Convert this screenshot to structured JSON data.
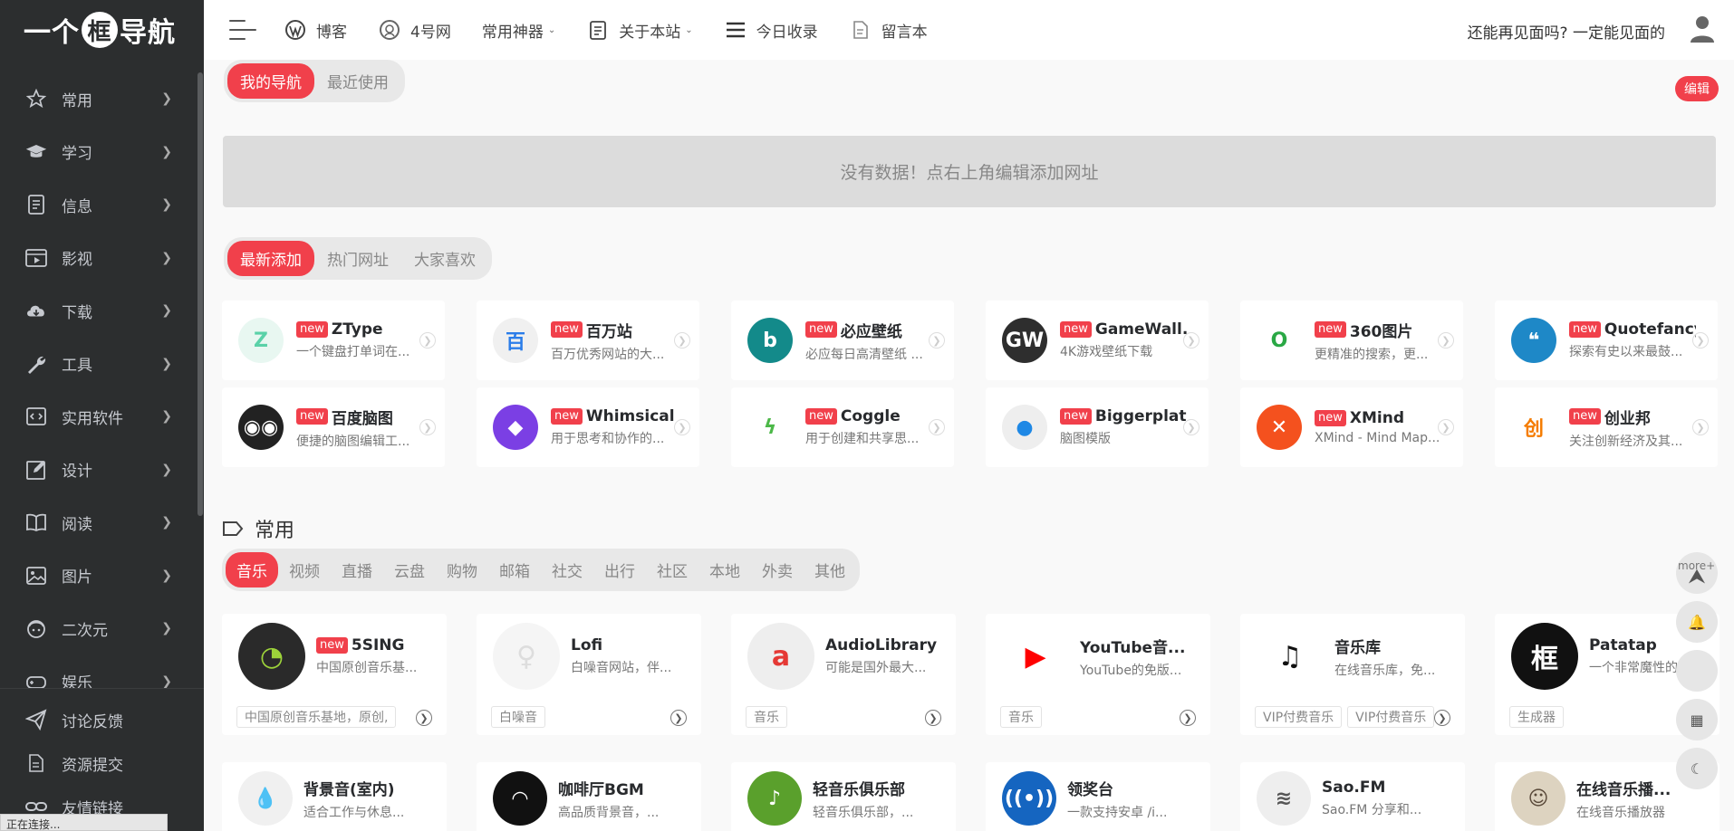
{
  "sidebar": {
    "logo_parts": [
      "一个",
      "框",
      "导航"
    ],
    "items": [
      {
        "label": "常用",
        "icon": "star-icon"
      },
      {
        "label": "学习",
        "icon": "graduation-cap-icon"
      },
      {
        "label": "信息",
        "icon": "document-icon"
      },
      {
        "label": "影视",
        "icon": "film-icon"
      },
      {
        "label": "下载",
        "icon": "cloud-download-icon"
      },
      {
        "label": "工具",
        "icon": "wrench-icon"
      },
      {
        "label": "实用软件",
        "icon": "code-icon"
      },
      {
        "label": "设计",
        "icon": "edit-icon"
      },
      {
        "label": "阅读",
        "icon": "book-icon"
      },
      {
        "label": "图片",
        "icon": "image-icon"
      },
      {
        "label": "二次元",
        "icon": "anime-icon"
      },
      {
        "label": "娱乐",
        "icon": "gamepad-icon"
      }
    ],
    "footer": [
      {
        "label": "讨论反馈",
        "icon": "paper-plane-icon"
      },
      {
        "label": "资源提交",
        "icon": "file-edit-icon"
      },
      {
        "label": "友情链接",
        "icon": "link-icon"
      }
    ],
    "status_text": "正在连接..."
  },
  "header": {
    "nav": [
      {
        "label": "博客",
        "icon": "wordpress-icon",
        "caret": false
      },
      {
        "label": "4号网",
        "icon": "smile-icon",
        "caret": false
      },
      {
        "label": "常用神器",
        "icon": "",
        "caret": true
      },
      {
        "label": "关于本站",
        "icon": "clipboard-icon",
        "caret": true
      },
      {
        "label": "今日收录",
        "icon": "list-icon",
        "caret": false
      },
      {
        "label": "留言本",
        "icon": "note-icon",
        "caret": false
      }
    ],
    "slogan": "还能再见面吗? 一定能见面的"
  },
  "my_nav": {
    "tabs": [
      "我的导航",
      "最近使用"
    ],
    "edit_label": "编辑",
    "empty_text": "没有数据！点右上角编辑添加网址"
  },
  "latest": {
    "tabs": [
      "最新添加",
      "热门网址",
      "大家喜欢"
    ],
    "badge": "new",
    "cards": [
      {
        "title": "ZType",
        "desc": "一个键盘打单词在...",
        "bg": "#e8f7f1",
        "fg": "#5ad1a8",
        "glyph": "Z"
      },
      {
        "title": "百万站",
        "desc": "百万优秀网站的大...",
        "bg": "#f0f0f0",
        "fg": "#2b7de9",
        "glyph": "百"
      },
      {
        "title": "必应壁纸",
        "desc": "必应每日高清壁纸 ...",
        "bg": "#138a8a",
        "fg": "#ffffff",
        "glyph": "b"
      },
      {
        "title": "GameWall...",
        "desc": "4K游戏壁纸下载",
        "bg": "#2e2e2e",
        "fg": "#ffffff",
        "glyph": "GW"
      },
      {
        "title": "360图片",
        "desc": "更精准的搜索，更...",
        "bg": "#ffffff",
        "fg": "#2aa845",
        "glyph": "O"
      },
      {
        "title": "Quotefancy",
        "desc": "探索有史以来最鼓...",
        "bg": "#1e88c7",
        "fg": "#ffffff",
        "glyph": "❝"
      },
      {
        "title": "百度脑图",
        "desc": "便捷的脑图编辑工...",
        "bg": "#222222",
        "fg": "#ffffff",
        "glyph": "◉◉"
      },
      {
        "title": "Whimsical",
        "desc": "用于思考和协作的...",
        "bg": "#7b3fe4",
        "fg": "#ffffff",
        "glyph": "◆"
      },
      {
        "title": "Coggle",
        "desc": "用于创建和共享思...",
        "bg": "#ffffff",
        "fg": "#4cb848",
        "glyph": "ϟ"
      },
      {
        "title": "Biggerplate",
        "desc": "脑图模版",
        "bg": "#eeeeee",
        "fg": "#1e88e5",
        "glyph": "●"
      },
      {
        "title": "XMind",
        "desc": "XMind - Mind Map...",
        "bg": "#f4511e",
        "fg": "#ffffff",
        "glyph": "✕"
      },
      {
        "title": "创业邦",
        "desc": "关注创新经济及其...",
        "bg": "#ffffff",
        "fg": "#f57c00",
        "glyph": "创"
      }
    ]
  },
  "common": {
    "title": "常用",
    "tabs": [
      "音乐",
      "视频",
      "直播",
      "云盘",
      "购物",
      "邮箱",
      "社交",
      "出行",
      "社区",
      "本地",
      "外卖",
      "其他"
    ],
    "cards": [
      {
        "title": "5SING",
        "new": true,
        "desc": "中国原创音乐基...",
        "tags": [
          "中国原创音乐基地，原创,"
        ],
        "bg": "#2a2a2a",
        "fg": "#9dd33a",
        "glyph": "◔"
      },
      {
        "title": "Lofi",
        "new": false,
        "desc": "白噪音网站，伴...",
        "tags": [
          "白噪音"
        ],
        "bg": "#f5f5f5",
        "fg": "#dddddd",
        "glyph": "♀"
      },
      {
        "title": "AudioLibrary",
        "new": false,
        "desc": "可能是国外最大...",
        "tags": [
          "音乐"
        ],
        "bg": "#eeeeee",
        "fg": "#e53935",
        "glyph": "a"
      },
      {
        "title": "YouTube音...",
        "new": false,
        "desc": "YouTube的免版...",
        "tags": [
          "音乐"
        ],
        "bg": "#ffffff",
        "fg": "#ff0000",
        "glyph": "▶"
      },
      {
        "title": "音乐库",
        "new": false,
        "desc": "在线音乐库，免...",
        "tags": [
          "VIP付费音乐",
          "VIP付费音乐"
        ],
        "bg": "#ffffff",
        "fg": "#111111",
        "glyph": "♫"
      },
      {
        "title": "Patatap",
        "new": false,
        "desc": "一个非常魔性的...",
        "tags": [
          "生成器"
        ],
        "bg": "#111111",
        "fg": "#ffffff",
        "glyph": "框"
      }
    ],
    "row2": [
      {
        "title": "背景音(室内)",
        "desc": "适合工作与休息...",
        "bg": "#f0f0f0",
        "fg": "#333333",
        "glyph": "💧"
      },
      {
        "title": "咖啡厅BGM",
        "desc": "高品质背景音，...",
        "bg": "#111111",
        "fg": "#ffffff",
        "glyph": "◠"
      },
      {
        "title": "轻音乐俱乐部",
        "desc": "轻音乐俱乐部，...",
        "bg": "#5aa02c",
        "fg": "#ffffff",
        "glyph": "♪"
      },
      {
        "title": "领奖台",
        "desc": "一款支持安卓 /i...",
        "bg": "#1565c0",
        "fg": "#ffffff",
        "glyph": "((•))"
      },
      {
        "title": "Sao.FM",
        "desc": "Sao.FM 分享和...",
        "bg": "#eeeeee",
        "fg": "#555555",
        "glyph": "≋"
      },
      {
        "title": "在线音乐播...",
        "desc": "在线音乐播放器",
        "bg": "#ddd3c0",
        "fg": "#5a4a3a",
        "glyph": "☺"
      }
    ]
  },
  "float": {
    "more_label": "more+"
  }
}
